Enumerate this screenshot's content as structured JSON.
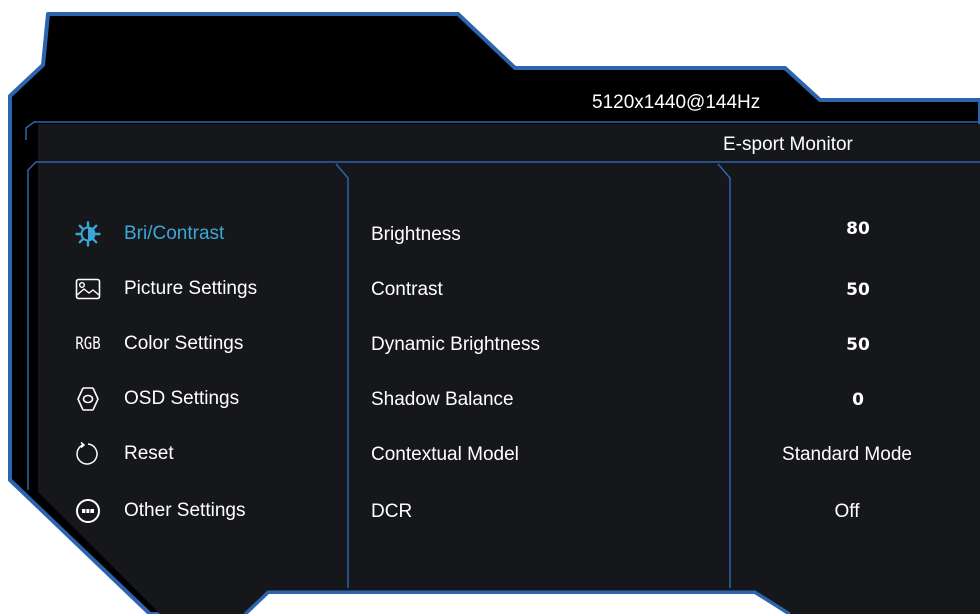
{
  "header": {
    "resolution": "5120x1440@144Hz",
    "model": "E-sport Monitor"
  },
  "colors": {
    "background": "#000000",
    "panel": "#16171b",
    "border": "#2d64ae",
    "accent": "#3aa7d8",
    "text": "#ffffff"
  },
  "menu": [
    {
      "label": "Bri/Contrast",
      "icon": "brightness-icon",
      "active": true
    },
    {
      "label": "Picture Settings",
      "icon": "picture-icon",
      "active": false
    },
    {
      "label": "Color Settings",
      "icon": "rgb-icon",
      "icon_text": "RGB",
      "active": false
    },
    {
      "label": "OSD Settings",
      "icon": "osd-icon",
      "active": false
    },
    {
      "label": "Reset",
      "icon": "reset-icon",
      "active": false
    },
    {
      "label": "Other Settings",
      "icon": "more-icon",
      "active": false
    }
  ],
  "params": [
    {
      "label": "Brightness",
      "value": "80"
    },
    {
      "label": "Contrast",
      "value": "50"
    },
    {
      "label": "Dynamic Brightness",
      "value": "50"
    },
    {
      "label": "Shadow Balance",
      "value": "0"
    },
    {
      "label": "Contextual Model",
      "value": "Standard Mode"
    },
    {
      "label": "DCR",
      "value": "Off"
    }
  ]
}
